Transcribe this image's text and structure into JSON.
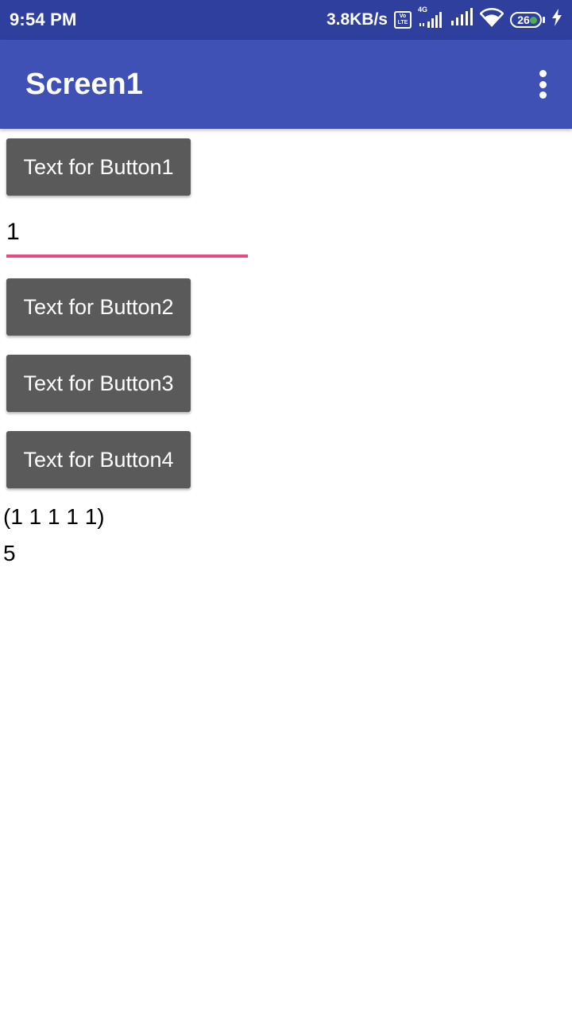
{
  "status_bar": {
    "time": "9:54 PM",
    "speed": "3.8KB/s",
    "volte_top": "Vo",
    "volte_bottom": "LTE",
    "network_type": "4G",
    "battery_level": "26"
  },
  "app_bar": {
    "title": "Screen1"
  },
  "main": {
    "button1_label": "Text for Button1",
    "text_input_value": "1",
    "button2_label": "Text for Button2",
    "button3_label": "Text for Button3",
    "button4_label": "Text for Button4",
    "list_label": "(1 1 1 1 1)",
    "count_label": "5"
  },
  "colors": {
    "status_bar": "#2f3f9e",
    "app_bar": "#3f51b5",
    "button": "#5a5a5a",
    "input_underline": "#e84a7f"
  }
}
